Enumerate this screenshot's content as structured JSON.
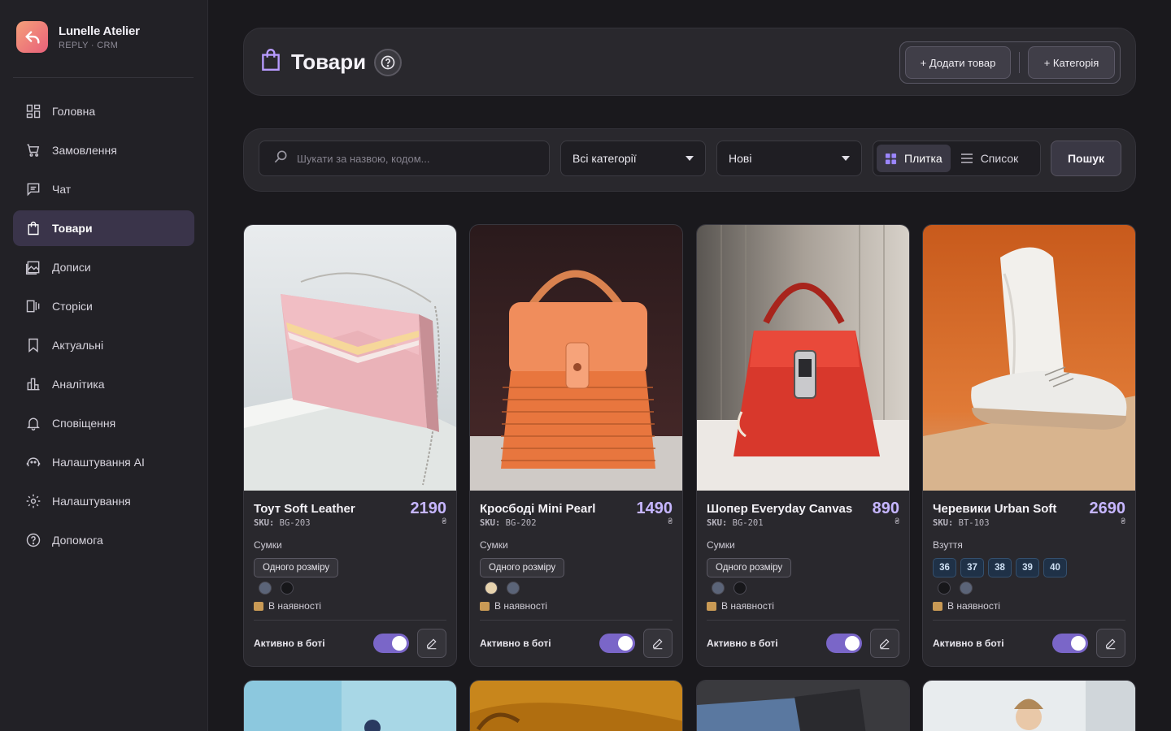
{
  "brand": {
    "name": "Lunelle Atelier",
    "subtitle": "REPLY · CRM"
  },
  "nav": [
    {
      "label": "Головна",
      "icon": "dashboard-icon"
    },
    {
      "label": "Замовлення",
      "icon": "cart-icon"
    },
    {
      "label": "Чат",
      "icon": "chat-icon"
    },
    {
      "label": "Товари",
      "icon": "shopping-bag-icon",
      "active": true
    },
    {
      "label": "Дописи",
      "icon": "image-icon"
    },
    {
      "label": "Сторіси",
      "icon": "stories-icon"
    },
    {
      "label": "Актуальні",
      "icon": "bookmark-icon"
    },
    {
      "label": "Аналітика",
      "icon": "bar-chart-icon"
    },
    {
      "label": "Сповіщення",
      "icon": "bell-icon"
    },
    {
      "label": "Налаштування AI",
      "icon": "ai-face-icon"
    },
    {
      "label": "Налаштування",
      "icon": "gear-icon"
    },
    {
      "label": "Допомога",
      "icon": "help-circle-icon"
    }
  ],
  "header": {
    "title": "Товари",
    "add_product": "+ Додати товар",
    "add_category": "+ Категорія"
  },
  "toolbar": {
    "search_placeholder": "Шукати за назвою, кодом...",
    "category_select": "Всі категорії",
    "sort_select": "Нові",
    "view_grid": "Плитка",
    "view_list": "Список",
    "search_button": "Пошук"
  },
  "products": [
    {
      "name": "Тоут Soft Leather",
      "price": "2190",
      "currency": "₴",
      "sku_label": "SKU:",
      "sku": "BG-203",
      "category": "Сумки",
      "sizes": [],
      "size_label": "Одного розміру",
      "colors": [
        "#5b6478",
        "#17171a"
      ],
      "stock": "В наявності",
      "active_label": "Активно в боті"
    },
    {
      "name": "Кросбоді Mini Pearl",
      "price": "1490",
      "currency": "₴",
      "sku_label": "SKU:",
      "sku": "BG-202",
      "category": "Сумки",
      "sizes": [],
      "size_label": "Одного розміру",
      "colors": [
        "#e7d3ae",
        "#5b6478"
      ],
      "stock": "В наявності",
      "active_label": "Активно в боті"
    },
    {
      "name": "Шопер Everyday Canvas",
      "price": "890",
      "currency": "₴",
      "sku_label": "SKU:",
      "sku": "BG-201",
      "category": "Сумки",
      "sizes": [],
      "size_label": "Одного розміру",
      "colors": [
        "#5b6478",
        "#17171a"
      ],
      "stock": "В наявності",
      "active_label": "Активно в боті"
    },
    {
      "name": "Черевики Urban Soft",
      "price": "2690",
      "currency": "₴",
      "sku_label": "SKU:",
      "sku": "BT-103",
      "category": "Взуття",
      "sizes": [
        "36",
        "37",
        "38",
        "39",
        "40"
      ],
      "size_label": "",
      "colors": [
        "#17171a",
        "#5b6478"
      ],
      "stock": "В наявності",
      "active_label": "Активно в боті"
    }
  ]
}
